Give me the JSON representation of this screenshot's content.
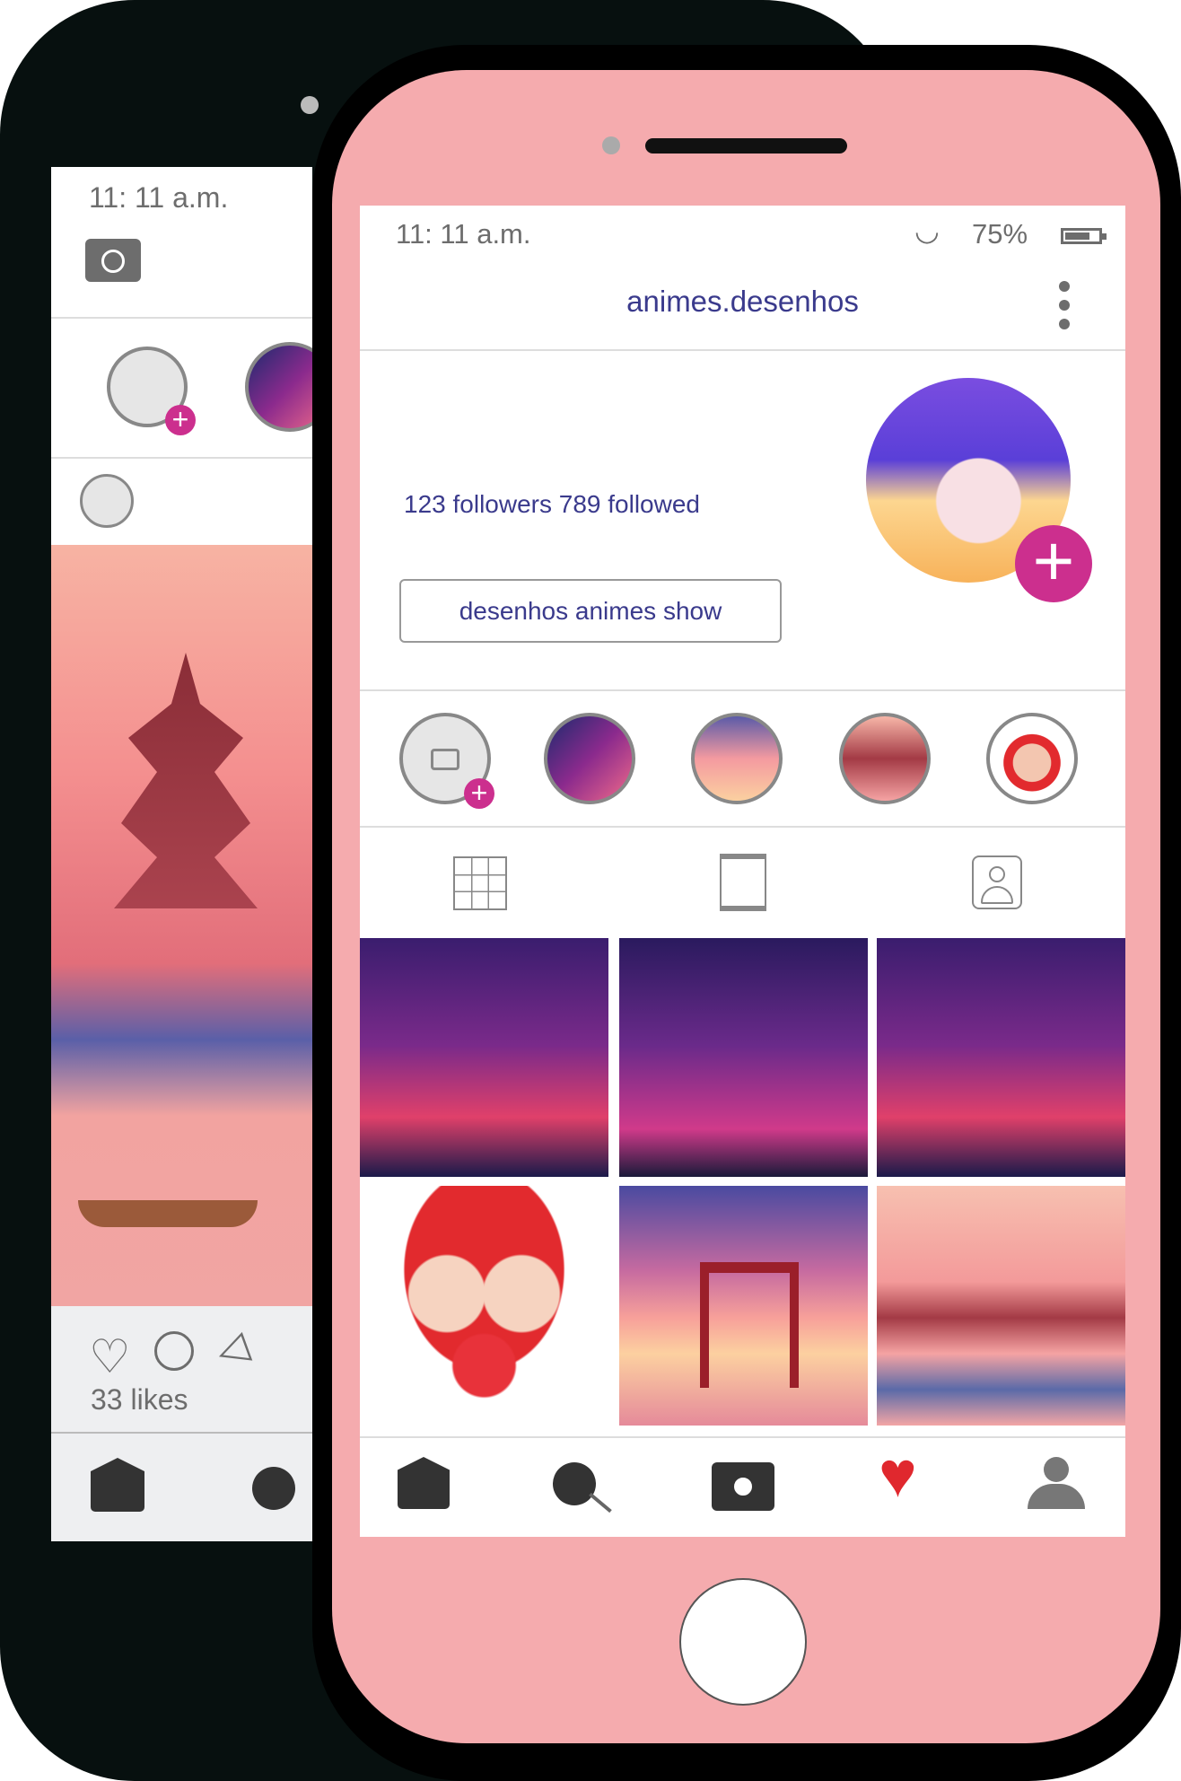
{
  "back_phone": {
    "status_time": "11: 11 a.m.",
    "likes": "33 likes",
    "icons": [
      "camera-icon",
      "heart-outline-icon",
      "comment-icon",
      "send-icon",
      "home-icon",
      "search-icon"
    ]
  },
  "front_phone": {
    "status": {
      "time": "11: 11 a.m.",
      "battery_percent": "75%",
      "battery_level": 0.75
    },
    "header": {
      "username": "animes.desenhos"
    },
    "profile": {
      "stats": "123 followers 789 followed",
      "button_label": "desenhos animes show"
    },
    "stories": [
      "add-story",
      "city-night",
      "torii-sunset",
      "pagoda",
      "couple"
    ],
    "tabs": [
      "grid-icon",
      "post-icon",
      "tagged-icon"
    ],
    "grid": [
      "city-bridge",
      "city-tower",
      "city-bridge",
      "anime-couple-heart",
      "torii-gate",
      "japanese-pagoda"
    ],
    "bottom_nav": [
      "home-icon",
      "search-icon",
      "camera-icon",
      "heart-icon",
      "profile-icon"
    ],
    "colors": {
      "accent": "#3a3a8c",
      "plus": "#cc2f8e",
      "phone": "#f5abae",
      "heart": "#e0282e"
    }
  }
}
